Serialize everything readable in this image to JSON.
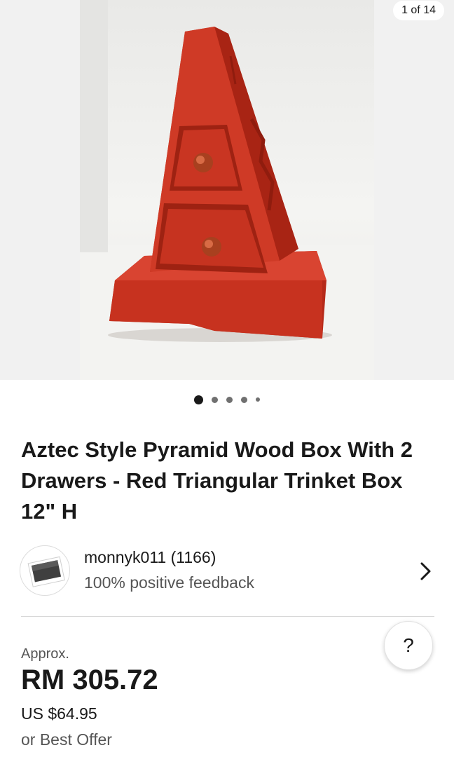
{
  "gallery": {
    "counter": "1 of 14",
    "photo_alt": "Red pyramid-shaped wooden box with two drawers",
    "dots": 5,
    "active_dot": 0
  },
  "listing": {
    "title": "Aztec Style Pyramid Wood Box With 2 Drawers - Red Triangular Trinket Box 12\" H"
  },
  "seller": {
    "name": "monnyk011 (1166)",
    "feedback": "100% positive feedback",
    "avatar_icon": "photo-placeholder-icon"
  },
  "price": {
    "approx_label": "Approx.",
    "local": "RM 305.72",
    "usd": "US $64.95",
    "best_offer": "or Best Offer"
  },
  "help": {
    "label": "?"
  },
  "colors": {
    "text": "#191919",
    "secondary_text": "#555555",
    "product_red": "#c8321f"
  }
}
